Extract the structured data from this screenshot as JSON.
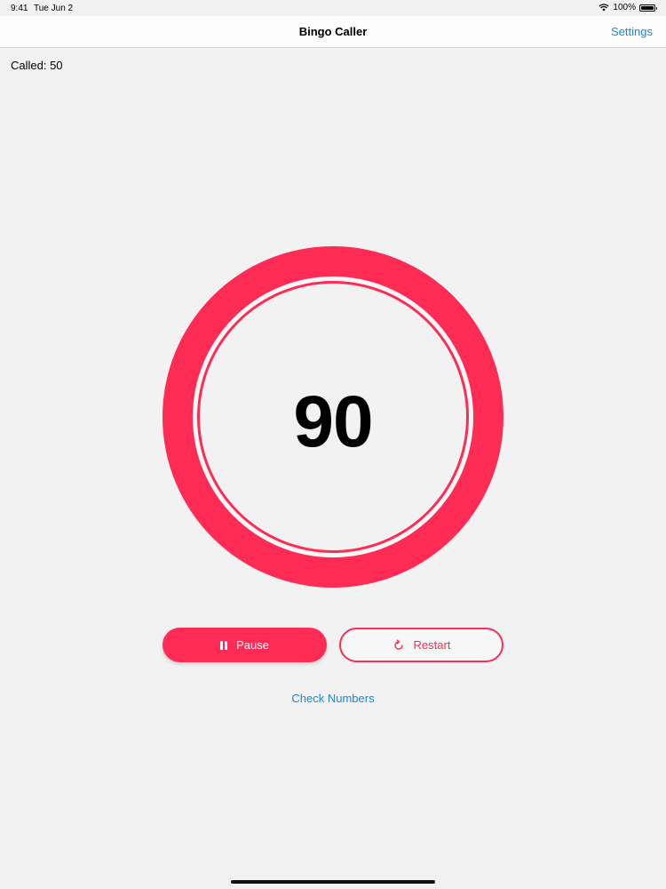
{
  "status_bar": {
    "time": "9:41",
    "date": "Tue Jun 2",
    "battery": "100%"
  },
  "nav": {
    "title": "Bingo Caller",
    "settings_label": "Settings"
  },
  "game": {
    "called_label": "Called: 50",
    "current_number": "90"
  },
  "controls": {
    "pause_label": "Pause",
    "restart_label": "Restart",
    "check_label": "Check Numbers"
  },
  "colors": {
    "accent": "#fe2c55",
    "link": "#1a8ad4",
    "background": "#f2f2f2"
  },
  "icons": [
    "wifi-icon",
    "battery-icon",
    "pause-icon",
    "restart-icon"
  ]
}
